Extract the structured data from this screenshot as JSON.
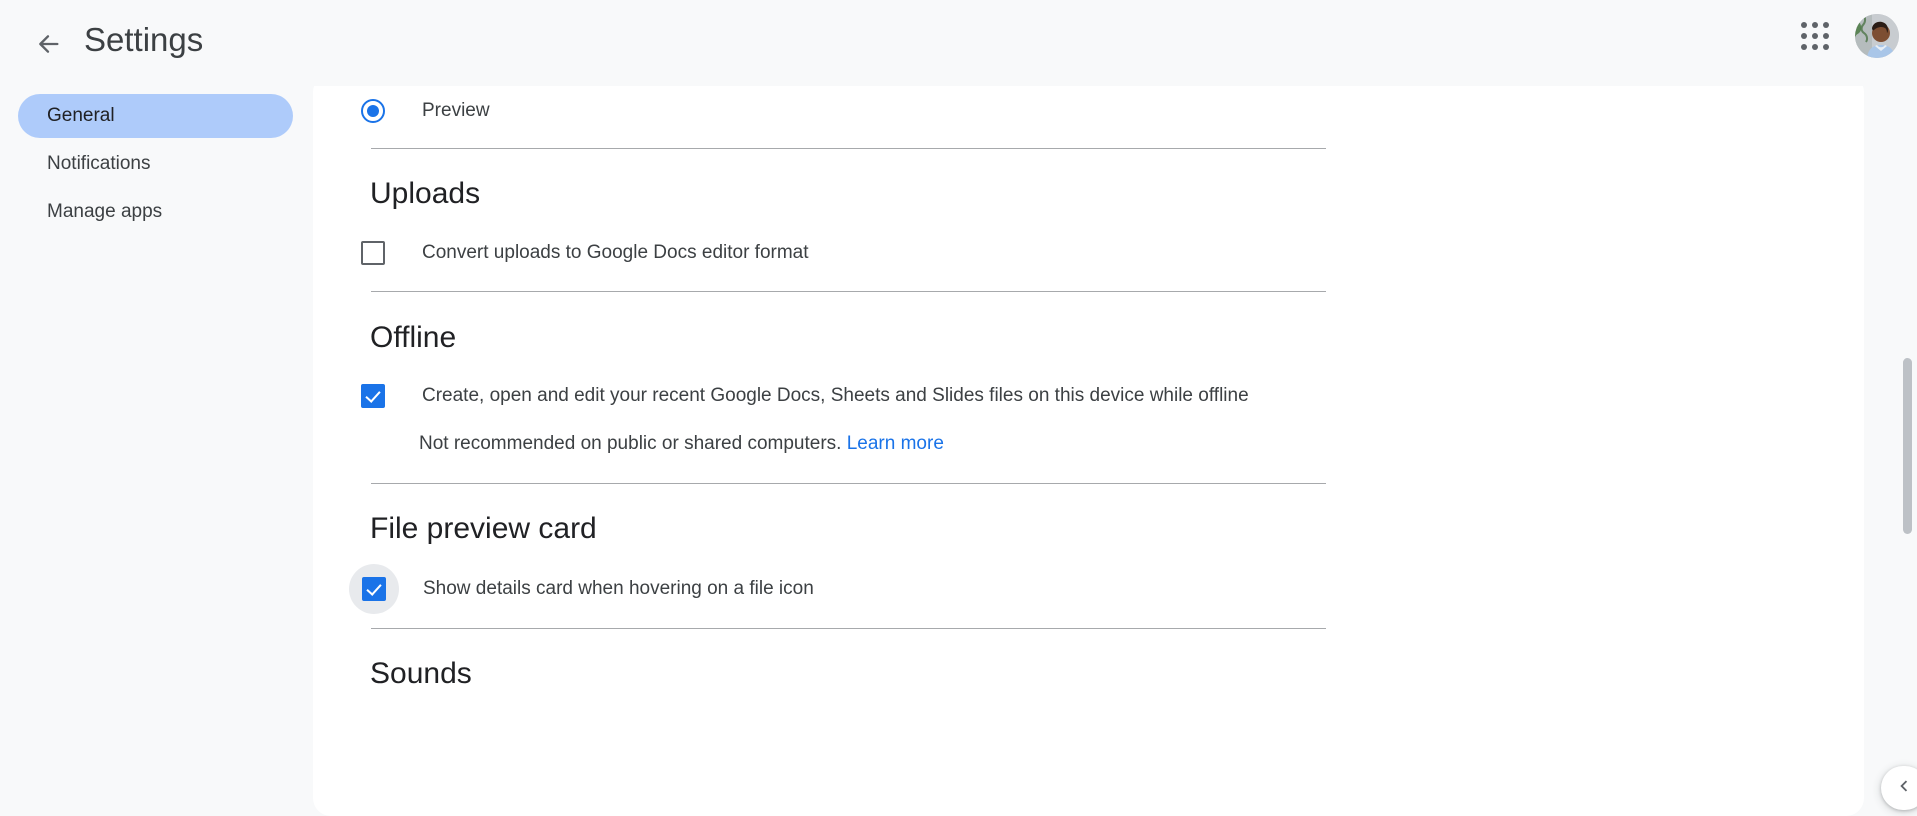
{
  "header": {
    "title": "Settings",
    "back_icon": "arrow-back-icon",
    "apps_icon": "google-apps-grid-icon",
    "avatar_label": "account-avatar"
  },
  "sidebar": {
    "items": [
      {
        "label": "General",
        "selected": true
      },
      {
        "label": "Notifications",
        "selected": false
      },
      {
        "label": "Manage apps",
        "selected": false
      }
    ]
  },
  "main": {
    "preview_option": {
      "label": "Preview",
      "selected": true
    },
    "sections": [
      {
        "title": "Uploads",
        "option_label": "Convert uploads to Google Docs editor format",
        "checked": false
      },
      {
        "title": "Offline",
        "option_label": "Create, open and edit your recent Google Docs, Sheets and Slides files on this device while offline",
        "checked": true,
        "sub_text": "Not recommended on public or shared computers.",
        "link_label": "Learn more"
      },
      {
        "title": "File preview card",
        "option_label": "Show details card when hovering on a file icon",
        "checked": true,
        "hovered": true
      },
      {
        "title": "Sounds"
      }
    ]
  },
  "controls": {
    "collapse_chevron": "chevron-left-icon",
    "scrollbar": "vertical-scrollbar"
  },
  "colors": {
    "accent_blue": "#1a73e8",
    "selected_pill": "#aecbfa",
    "link_blue": "#1a73e8",
    "page_bg": "#f8f9fa",
    "card_bg": "#ffffff",
    "text_primary": "#202124",
    "text_secondary": "#3c4043"
  }
}
